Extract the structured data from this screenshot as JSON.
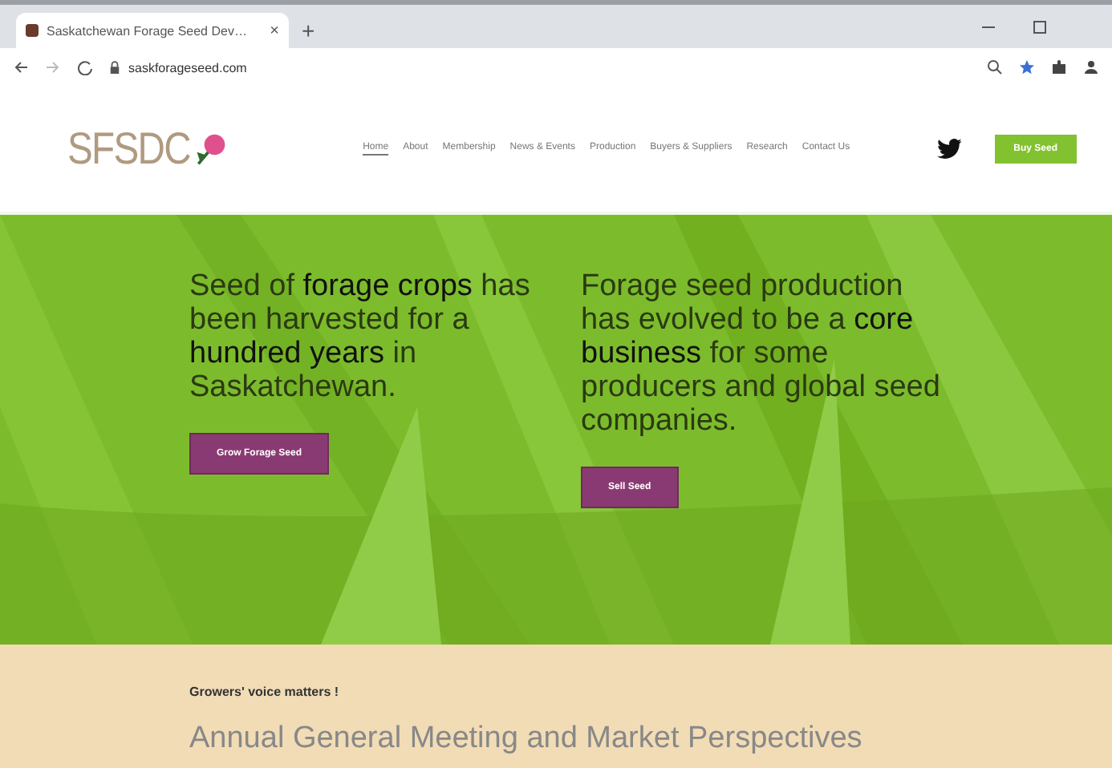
{
  "browser": {
    "tab_title": "Saskatchewan Forage Seed Dev…",
    "tab_close": "×",
    "new_tab": "+",
    "url": "saskforageseed.com"
  },
  "header": {
    "logo": "SFSDC",
    "nav": [
      {
        "label": "Home",
        "selected": true
      },
      {
        "label": "About",
        "selected": false
      },
      {
        "label": "Membership",
        "selected": false
      },
      {
        "label": "News & Events",
        "selected": false
      },
      {
        "label": "Production",
        "selected": false
      },
      {
        "label": "Buyers & Suppliers",
        "selected": false
      },
      {
        "label": "Research",
        "selected": false
      },
      {
        "label": "Contact Us",
        "selected": false
      }
    ],
    "cta": "Buy Seed"
  },
  "hero": {
    "columns": [
      {
        "text": "Seed of **forage crops** has been harvested for a **hundred years** in Saskatchewan.",
        "button": "Grow Forage Seed"
      },
      {
        "text": "Forage seed production has evolved to be a **core business** for some producers and global seed companies.",
        "button": "Sell Seed"
      }
    ]
  },
  "news": {
    "kicker": "Growers' voice matters !",
    "heading": "Annual General Meeting and Market Perspectives"
  }
}
